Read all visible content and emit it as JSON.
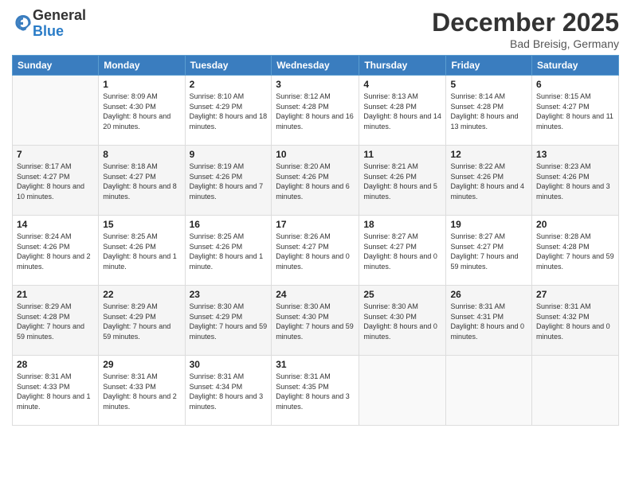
{
  "logo": {
    "general": "General",
    "blue": "Blue"
  },
  "header": {
    "month": "December 2025",
    "location": "Bad Breisig, Germany"
  },
  "days_of_week": [
    "Sunday",
    "Monday",
    "Tuesday",
    "Wednesday",
    "Thursday",
    "Friday",
    "Saturday"
  ],
  "weeks": [
    [
      {
        "num": "",
        "sunrise": "",
        "sunset": "",
        "daylight": ""
      },
      {
        "num": "1",
        "sunrise": "Sunrise: 8:09 AM",
        "sunset": "Sunset: 4:30 PM",
        "daylight": "Daylight: 8 hours and 20 minutes."
      },
      {
        "num": "2",
        "sunrise": "Sunrise: 8:10 AM",
        "sunset": "Sunset: 4:29 PM",
        "daylight": "Daylight: 8 hours and 18 minutes."
      },
      {
        "num": "3",
        "sunrise": "Sunrise: 8:12 AM",
        "sunset": "Sunset: 4:28 PM",
        "daylight": "Daylight: 8 hours and 16 minutes."
      },
      {
        "num": "4",
        "sunrise": "Sunrise: 8:13 AM",
        "sunset": "Sunset: 4:28 PM",
        "daylight": "Daylight: 8 hours and 14 minutes."
      },
      {
        "num": "5",
        "sunrise": "Sunrise: 8:14 AM",
        "sunset": "Sunset: 4:28 PM",
        "daylight": "Daylight: 8 hours and 13 minutes."
      },
      {
        "num": "6",
        "sunrise": "Sunrise: 8:15 AM",
        "sunset": "Sunset: 4:27 PM",
        "daylight": "Daylight: 8 hours and 11 minutes."
      }
    ],
    [
      {
        "num": "7",
        "sunrise": "Sunrise: 8:17 AM",
        "sunset": "Sunset: 4:27 PM",
        "daylight": "Daylight: 8 hours and 10 minutes."
      },
      {
        "num": "8",
        "sunrise": "Sunrise: 8:18 AM",
        "sunset": "Sunset: 4:27 PM",
        "daylight": "Daylight: 8 hours and 8 minutes."
      },
      {
        "num": "9",
        "sunrise": "Sunrise: 8:19 AM",
        "sunset": "Sunset: 4:26 PM",
        "daylight": "Daylight: 8 hours and 7 minutes."
      },
      {
        "num": "10",
        "sunrise": "Sunrise: 8:20 AM",
        "sunset": "Sunset: 4:26 PM",
        "daylight": "Daylight: 8 hours and 6 minutes."
      },
      {
        "num": "11",
        "sunrise": "Sunrise: 8:21 AM",
        "sunset": "Sunset: 4:26 PM",
        "daylight": "Daylight: 8 hours and 5 minutes."
      },
      {
        "num": "12",
        "sunrise": "Sunrise: 8:22 AM",
        "sunset": "Sunset: 4:26 PM",
        "daylight": "Daylight: 8 hours and 4 minutes."
      },
      {
        "num": "13",
        "sunrise": "Sunrise: 8:23 AM",
        "sunset": "Sunset: 4:26 PM",
        "daylight": "Daylight: 8 hours and 3 minutes."
      }
    ],
    [
      {
        "num": "14",
        "sunrise": "Sunrise: 8:24 AM",
        "sunset": "Sunset: 4:26 PM",
        "daylight": "Daylight: 8 hours and 2 minutes."
      },
      {
        "num": "15",
        "sunrise": "Sunrise: 8:25 AM",
        "sunset": "Sunset: 4:26 PM",
        "daylight": "Daylight: 8 hours and 1 minute."
      },
      {
        "num": "16",
        "sunrise": "Sunrise: 8:25 AM",
        "sunset": "Sunset: 4:26 PM",
        "daylight": "Daylight: 8 hours and 1 minute."
      },
      {
        "num": "17",
        "sunrise": "Sunrise: 8:26 AM",
        "sunset": "Sunset: 4:27 PM",
        "daylight": "Daylight: 8 hours and 0 minutes."
      },
      {
        "num": "18",
        "sunrise": "Sunrise: 8:27 AM",
        "sunset": "Sunset: 4:27 PM",
        "daylight": "Daylight: 8 hours and 0 minutes."
      },
      {
        "num": "19",
        "sunrise": "Sunrise: 8:27 AM",
        "sunset": "Sunset: 4:27 PM",
        "daylight": "Daylight: 7 hours and 59 minutes."
      },
      {
        "num": "20",
        "sunrise": "Sunrise: 8:28 AM",
        "sunset": "Sunset: 4:28 PM",
        "daylight": "Daylight: 7 hours and 59 minutes."
      }
    ],
    [
      {
        "num": "21",
        "sunrise": "Sunrise: 8:29 AM",
        "sunset": "Sunset: 4:28 PM",
        "daylight": "Daylight: 7 hours and 59 minutes."
      },
      {
        "num": "22",
        "sunrise": "Sunrise: 8:29 AM",
        "sunset": "Sunset: 4:29 PM",
        "daylight": "Daylight: 7 hours and 59 minutes."
      },
      {
        "num": "23",
        "sunrise": "Sunrise: 8:30 AM",
        "sunset": "Sunset: 4:29 PM",
        "daylight": "Daylight: 7 hours and 59 minutes."
      },
      {
        "num": "24",
        "sunrise": "Sunrise: 8:30 AM",
        "sunset": "Sunset: 4:30 PM",
        "daylight": "Daylight: 7 hours and 59 minutes."
      },
      {
        "num": "25",
        "sunrise": "Sunrise: 8:30 AM",
        "sunset": "Sunset: 4:30 PM",
        "daylight": "Daylight: 8 hours and 0 minutes."
      },
      {
        "num": "26",
        "sunrise": "Sunrise: 8:31 AM",
        "sunset": "Sunset: 4:31 PM",
        "daylight": "Daylight: 8 hours and 0 minutes."
      },
      {
        "num": "27",
        "sunrise": "Sunrise: 8:31 AM",
        "sunset": "Sunset: 4:32 PM",
        "daylight": "Daylight: 8 hours and 0 minutes."
      }
    ],
    [
      {
        "num": "28",
        "sunrise": "Sunrise: 8:31 AM",
        "sunset": "Sunset: 4:33 PM",
        "daylight": "Daylight: 8 hours and 1 minute."
      },
      {
        "num": "29",
        "sunrise": "Sunrise: 8:31 AM",
        "sunset": "Sunset: 4:33 PM",
        "daylight": "Daylight: 8 hours and 2 minutes."
      },
      {
        "num": "30",
        "sunrise": "Sunrise: 8:31 AM",
        "sunset": "Sunset: 4:34 PM",
        "daylight": "Daylight: 8 hours and 3 minutes."
      },
      {
        "num": "31",
        "sunrise": "Sunrise: 8:31 AM",
        "sunset": "Sunset: 4:35 PM",
        "daylight": "Daylight: 8 hours and 3 minutes."
      },
      {
        "num": "",
        "sunrise": "",
        "sunset": "",
        "daylight": ""
      },
      {
        "num": "",
        "sunrise": "",
        "sunset": "",
        "daylight": ""
      },
      {
        "num": "",
        "sunrise": "",
        "sunset": "",
        "daylight": ""
      }
    ]
  ]
}
